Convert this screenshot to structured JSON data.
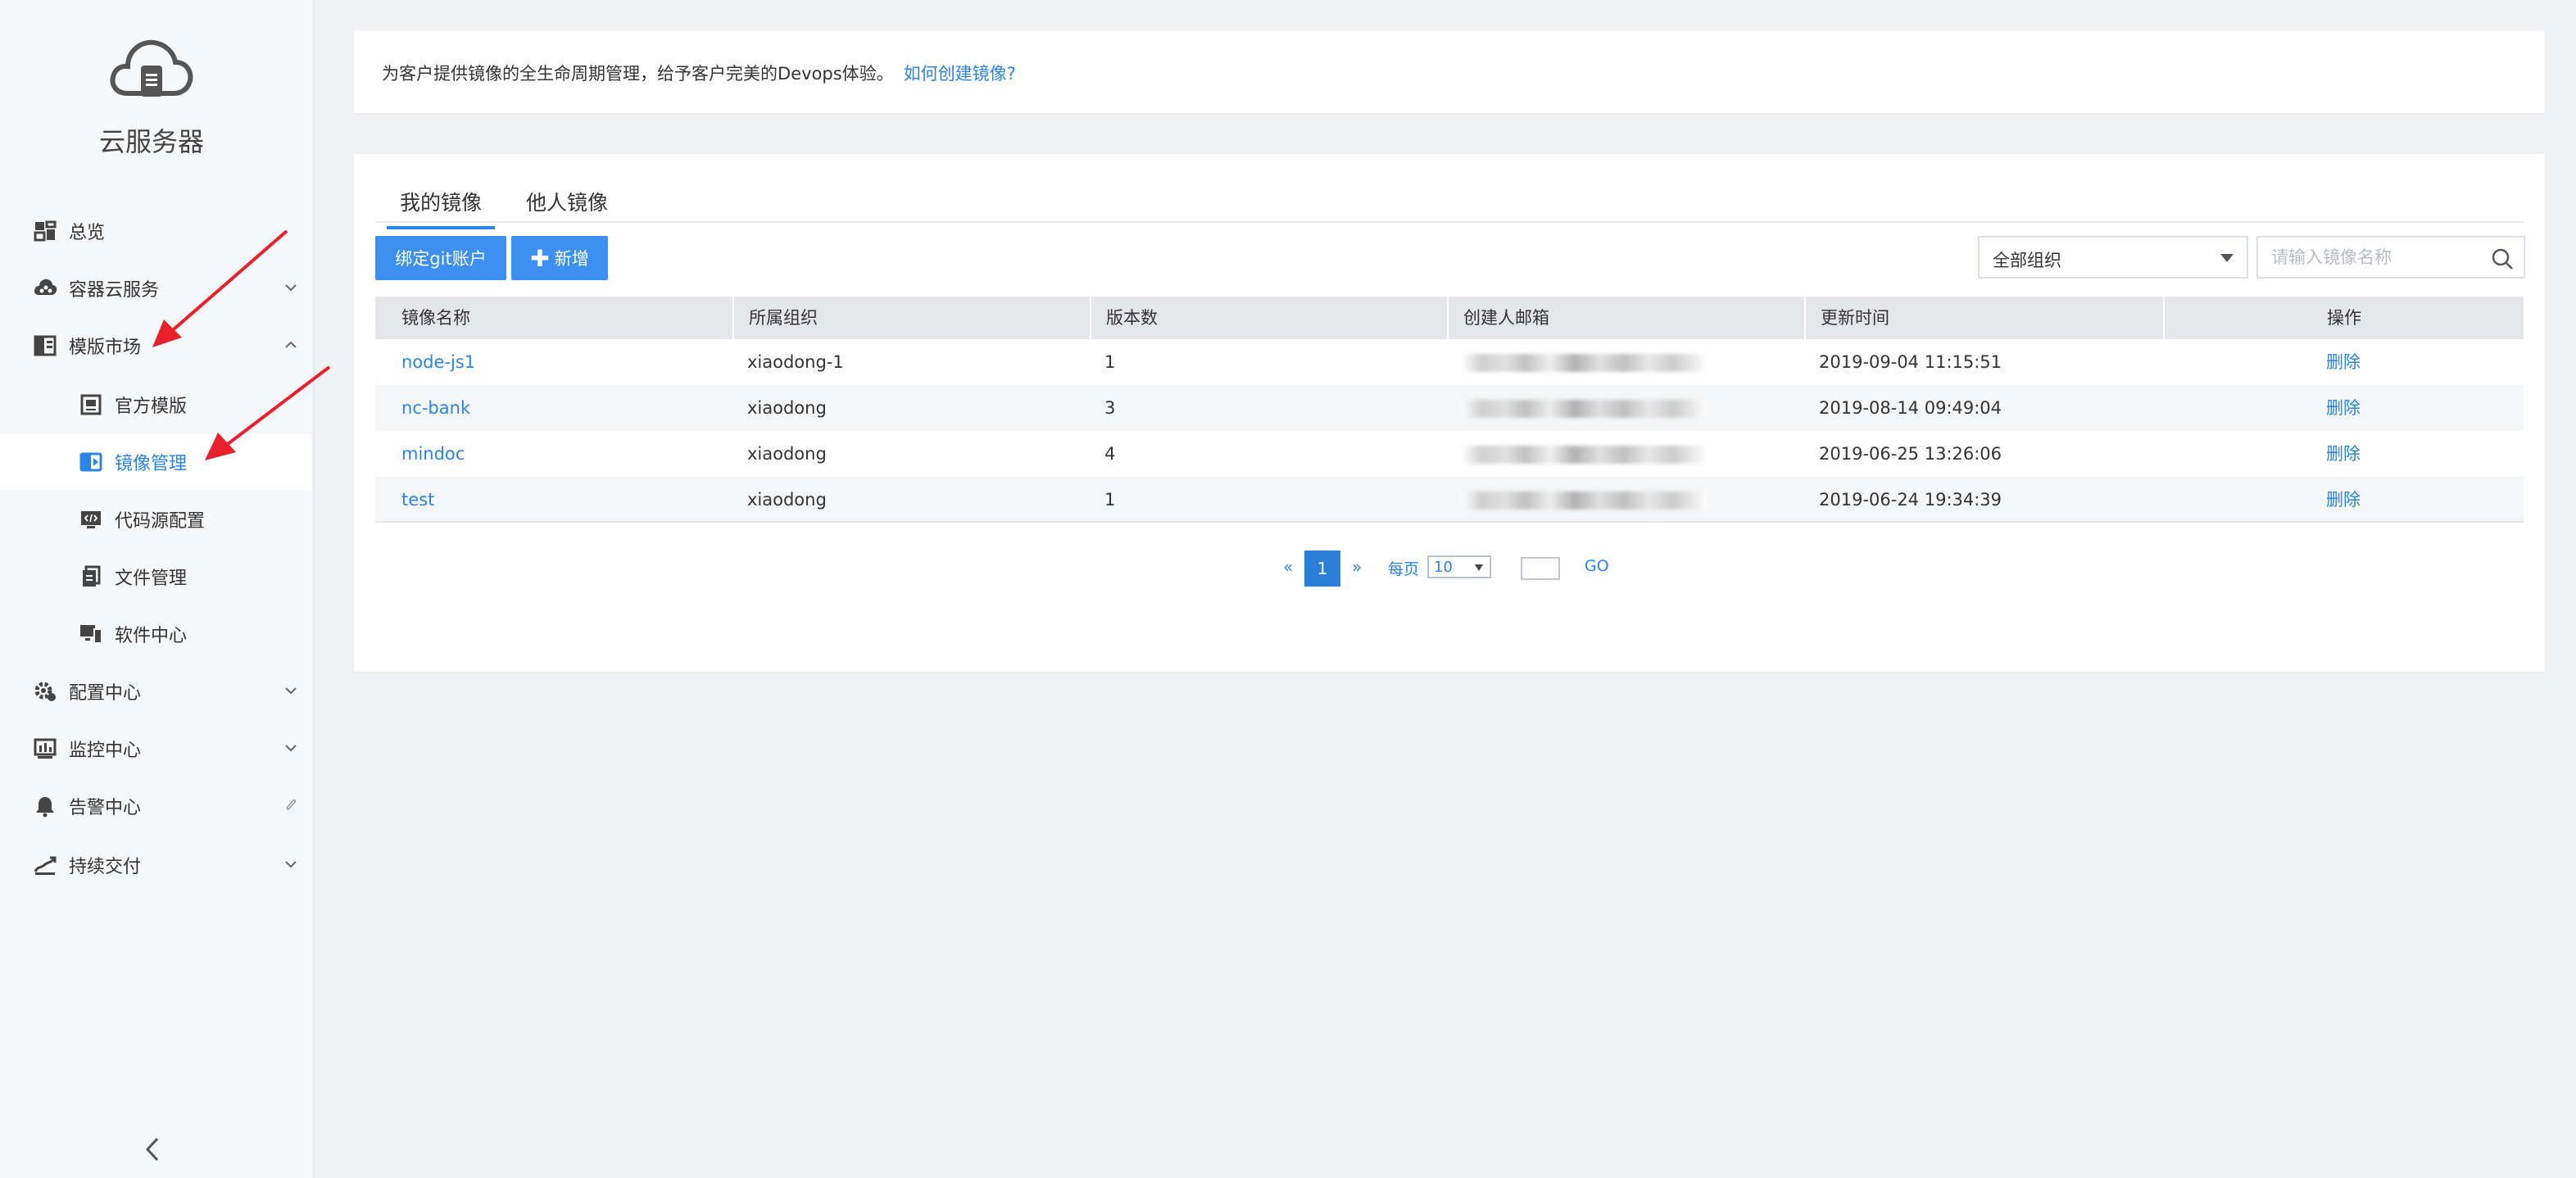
{
  "app": {
    "title": "云服务器"
  },
  "sidebar": {
    "items": [
      {
        "label": "总览",
        "icon": "dashboard-icon"
      },
      {
        "label": "容器云服务",
        "icon": "cloud-service-icon",
        "expandable": true
      },
      {
        "label": "模版市场",
        "icon": "template-market-icon",
        "expanded": true
      },
      {
        "label": "官方模版",
        "icon": "official-template-icon",
        "sub": true
      },
      {
        "label": "镜像管理",
        "icon": "image-manage-icon",
        "sub": true,
        "active": true
      },
      {
        "label": "代码源配置",
        "icon": "code-source-icon",
        "sub": true
      },
      {
        "label": "文件管理",
        "icon": "file-manage-icon",
        "sub": true
      },
      {
        "label": "软件中心",
        "icon": "software-center-icon",
        "sub": true
      },
      {
        "label": "配置中心",
        "icon": "config-center-icon",
        "expandable": true
      },
      {
        "label": "监控中心",
        "icon": "monitor-center-icon",
        "expandable": true
      },
      {
        "label": "告警中心",
        "icon": "alarm-center-icon"
      },
      {
        "label": "持续交付",
        "icon": "delivery-icon",
        "expandable": true
      }
    ]
  },
  "info": {
    "text": "为客户提供镜像的全生命周期管理，给予客户完美的Devops体验。",
    "link": "如何创建镜像?"
  },
  "tabs": [
    {
      "label": "我的镜像",
      "active": true
    },
    {
      "label": "他人镜像"
    }
  ],
  "toolbar": {
    "bind_git_label": "绑定git账户",
    "add_label": "新增",
    "org_select_value": "全部组织",
    "search_placeholder": "请输入镜像名称"
  },
  "table": {
    "headers": [
      "镜像名称",
      "所属组织",
      "版本数",
      "创建人邮箱",
      "更新时间",
      "操作"
    ],
    "rows": [
      {
        "name": "node-js1",
        "org": "xiaodong-1",
        "versions": "1",
        "updated": "2019-09-04 11:15:51",
        "action": "删除"
      },
      {
        "name": "nc-bank",
        "org": "xiaodong",
        "versions": "3",
        "updated": "2019-08-14 09:49:04",
        "action": "删除"
      },
      {
        "name": "mindoc",
        "org": "xiaodong",
        "versions": "4",
        "updated": "2019-06-25 13:26:06",
        "action": "删除"
      },
      {
        "name": "test",
        "org": "xiaodong",
        "versions": "1",
        "updated": "2019-06-24 19:34:39",
        "action": "删除"
      }
    ]
  },
  "pagination": {
    "prev": "«",
    "current": "1",
    "next": "»",
    "per_page_label": "每页",
    "per_page_value": "10",
    "go_label": "GO"
  },
  "colors": {
    "accent": "#2b84e6",
    "button": "#3d8ff0",
    "annotation_arrow": "#e8202a"
  }
}
